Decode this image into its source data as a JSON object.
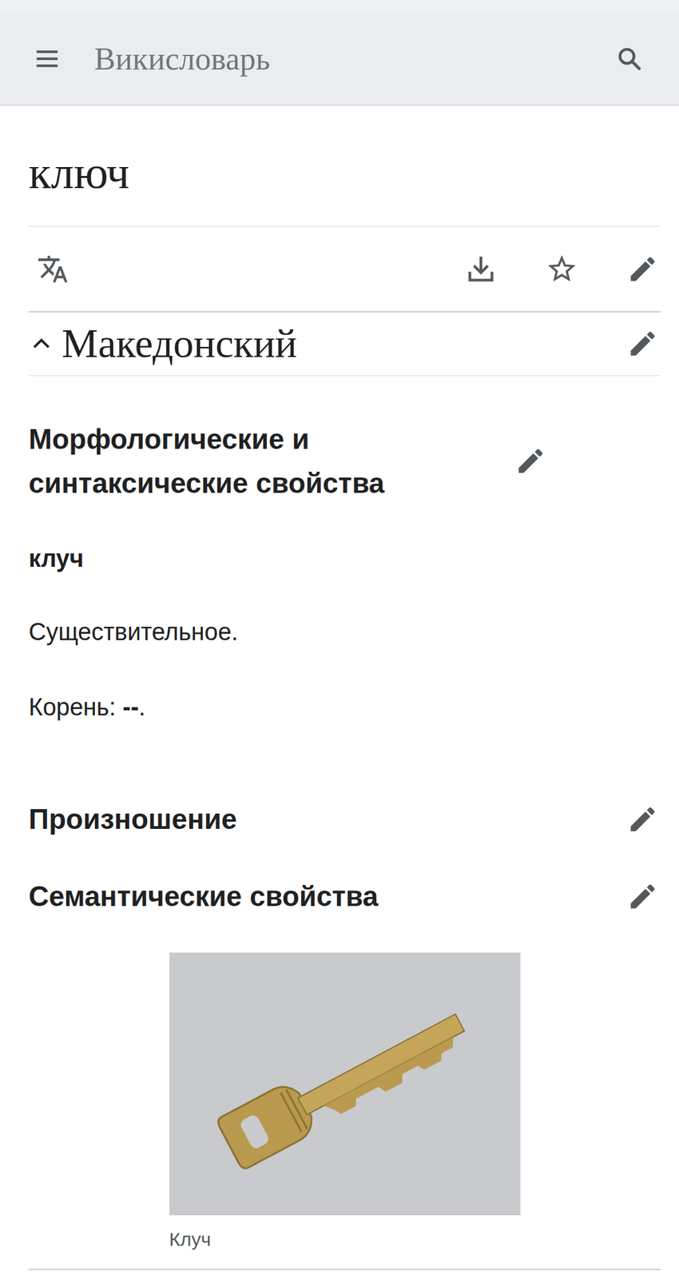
{
  "header": {
    "title": "Викисловарь"
  },
  "page": {
    "title": "ключ"
  },
  "section": {
    "language": "Македонский",
    "expanded": true
  },
  "morphology": {
    "heading": "Морфологические и синтаксические свойства",
    "headword": "клуч",
    "pos": "Существительное.",
    "root_label": "Корень:",
    "root_value": "--",
    "root_end": "."
  },
  "pronunciation": {
    "heading": "Произношение"
  },
  "semantics": {
    "heading": "Семантические свойства",
    "caption": "Клуч"
  }
}
